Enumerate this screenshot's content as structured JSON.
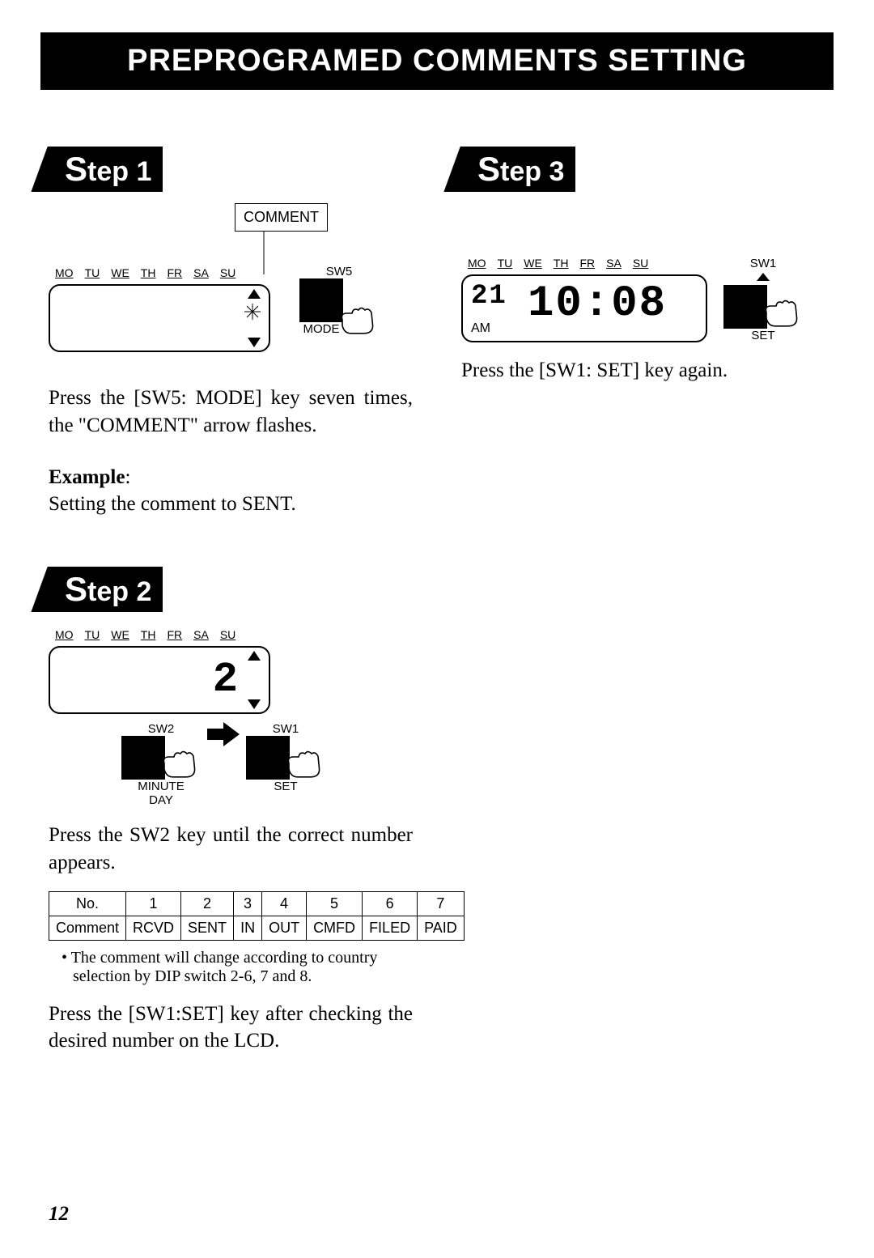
{
  "title": "PREPROGRAMED COMMENTS SETTING",
  "page_number": "12",
  "days": [
    "MO",
    "TU",
    "WE",
    "TH",
    "FR",
    "SA",
    "SU"
  ],
  "step1": {
    "tag_prefix": "S",
    "tag_rest": "tep 1",
    "comment_label": "COMMENT",
    "sw_label": "SW5",
    "mode_label": "MODE",
    "text": "Press the  [SW5: MODE] key seven times, the \"COMMENT\" arrow flashes.",
    "example_label": "Example",
    "example_text": "Setting the comment to SENT."
  },
  "step2": {
    "tag_prefix": "S",
    "tag_rest": "tep 2",
    "lcd_value": "2",
    "sw2": "SW2",
    "sw2_sub1": "MINUTE",
    "sw2_sub2": "DAY",
    "sw1": "SW1",
    "sw1_sub": "SET",
    "text1": "Press the SW2 key until the correct number appears.",
    "table": {
      "head1": "No.",
      "head2": "Comment",
      "nums": [
        "1",
        "2",
        "3",
        "4",
        "5",
        "6",
        "7"
      ],
      "vals": [
        "RCVD",
        "SENT",
        "IN",
        "OUT",
        "CMFD",
        "FILED",
        "PAID"
      ]
    },
    "bullet": "• The comment will change according to country selection by DIP switch 2-6, 7 and 8.",
    "text2": "Press the [SW1:SET] key after checking the desired number on the LCD."
  },
  "step3": {
    "tag_prefix": "S",
    "tag_rest": "tep 3",
    "sw_label": "SW1",
    "set_label": "SET",
    "lcd_day": "21",
    "lcd_ampm": "AM",
    "lcd_time": "10:08",
    "text": "Press the [SW1: SET] key again."
  }
}
